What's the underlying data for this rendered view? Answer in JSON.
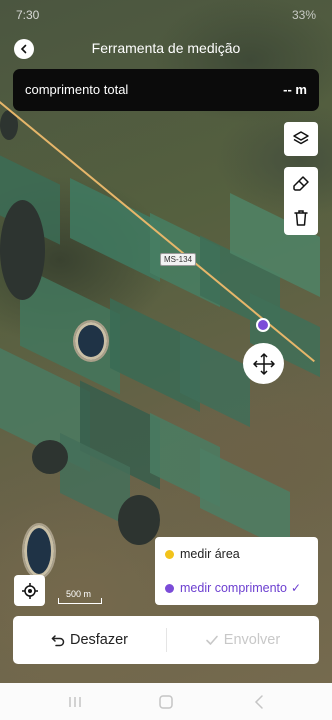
{
  "status_bar": {
    "time": "7:30",
    "battery": "33%"
  },
  "header": {
    "title": "Ferramenta de medição"
  },
  "measure": {
    "label": "comprimento total",
    "value": "-- m"
  },
  "map": {
    "road_label": "MS-134",
    "scale_label": "500 m"
  },
  "mode_menu": {
    "area_label": "medir área",
    "length_label": "medir comprimento",
    "selected": "medir comprimento"
  },
  "actions": {
    "undo_label": "Desfazer",
    "wrap_label": "Envolver"
  },
  "colors": {
    "accent": "#7b4cd8",
    "area_dot": "#f2c31b",
    "toolbar_bg": "#0b0b0b"
  },
  "icons": [
    "back-icon",
    "layers-icon",
    "eraser-icon",
    "trash-icon",
    "move-icon",
    "locate-icon",
    "undo-icon",
    "check-icon"
  ]
}
